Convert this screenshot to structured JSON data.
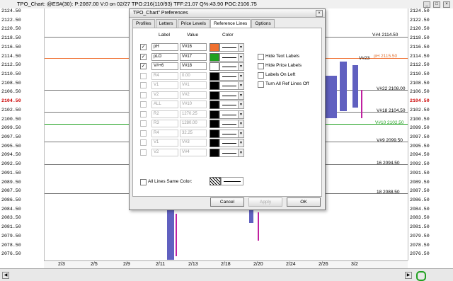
{
  "window": {
    "title": "TPO_Chart: @ES#(30): P:2087.00 V:0 on 02/27 TPO:216(110/93) TFF:21.07 Q%:43.90 POC:2106.75"
  },
  "price_axis": {
    "left_ticks": [
      "2124.50",
      "2122.50",
      "2120.50",
      "2118.50",
      "2116.50",
      "2114.50",
      "2112.50",
      "2110.50",
      "2108.50",
      "2106.50",
      "2104.50",
      "2102.50",
      "2100.50",
      "2099.50",
      "2097.50",
      "2095.50",
      "2094.50",
      "2092.50",
      "2091.50",
      "2089.50",
      "2087.50",
      "2086.50",
      "2084.50",
      "2083.50",
      "2081.50",
      "2079.50",
      "2078.50",
      "2076.50"
    ],
    "right_ticks": [
      "2124.50",
      "2122.50",
      "2120.50",
      "2118.50",
      "2116.50",
      "2114.50",
      "2112.50",
      "2110.50",
      "2108.50",
      "2106.50",
      "2104.50",
      "2102.50",
      "2100.50",
      "2099.50",
      "2097.50",
      "2095.50",
      "2094.50",
      "2092.50",
      "2091.50",
      "2089.50",
      "2087.50",
      "2086.50",
      "2084.50",
      "2083.50",
      "2081.50",
      "2079.50",
      "2078.50",
      "2076.50"
    ],
    "highlight_tick": "2104.50",
    "highlight_color": "#cc0000"
  },
  "chart_labels": {
    "v4": "V#4 2114.50",
    "v23": "V#23",
    "ph": "pH 2115.50",
    "v22": "V#22 2108.00",
    "v18": "V#18 2104.50",
    "v10": "V#10 2102.50",
    "v9": "V#9 2099.50",
    "l16": "16 2094.50",
    "l18": "18 2088.50"
  },
  "date_axis": [
    "2/3",
    "2/5",
    "2/9",
    "2/11",
    "2/13",
    "2/18",
    "2/20",
    "2/24",
    "2/26",
    "3/2"
  ],
  "dialog": {
    "title": "TPO_Chart\" Preferences",
    "tabs": [
      "Profiles",
      "Letters",
      "Price Levels",
      "Reference Lines",
      "Options"
    ],
    "active_tab": "Reference Lines",
    "headers": {
      "label": "Label",
      "value": "Value",
      "color": "Color"
    },
    "rows": [
      {
        "checked": true,
        "enabled": true,
        "label": "pH",
        "value": "V#16",
        "color": "#f07030"
      },
      {
        "checked": true,
        "enabled": true,
        "label": "pLO",
        "value": "V#17",
        "color": "#20a020"
      },
      {
        "checked": true,
        "enabled": true,
        "label": "V#+6",
        "value": "V#18",
        "color": "#ffffff"
      },
      {
        "checked": false,
        "enabled": false,
        "label": "R4",
        "value": "0.00",
        "color": "#000000"
      },
      {
        "checked": false,
        "enabled": false,
        "label": "V1",
        "value": "V#1",
        "color": "#000000"
      },
      {
        "checked": false,
        "enabled": false,
        "label": "V2",
        "value": "V#2",
        "color": "#000000"
      },
      {
        "checked": false,
        "enabled": false,
        "label": "ALL",
        "value": "V#10",
        "color": "#000000"
      },
      {
        "checked": false,
        "enabled": false,
        "label": "R2",
        "value": "1270.25",
        "color": "#000000"
      },
      {
        "checked": false,
        "enabled": false,
        "label": "R3",
        "value": "1280.00",
        "color": "#000000"
      },
      {
        "checked": false,
        "enabled": false,
        "label": "R4",
        "value": "32.25",
        "color": "#000000"
      },
      {
        "checked": false,
        "enabled": false,
        "label": "V1",
        "value": "V#3",
        "color": "#000000"
      },
      {
        "checked": false,
        "enabled": false,
        "label": "V2",
        "value": "V#4",
        "color": "#000000"
      }
    ],
    "options": [
      "Hide Text Labels",
      "Hide Price Labels",
      "Labels On Left",
      "Turn All Ref Lines Off"
    ],
    "all_same_color": "All Lines Same Color:",
    "buttons": {
      "cancel": "Cancel",
      "apply": "Apply",
      "ok": "OK"
    }
  }
}
